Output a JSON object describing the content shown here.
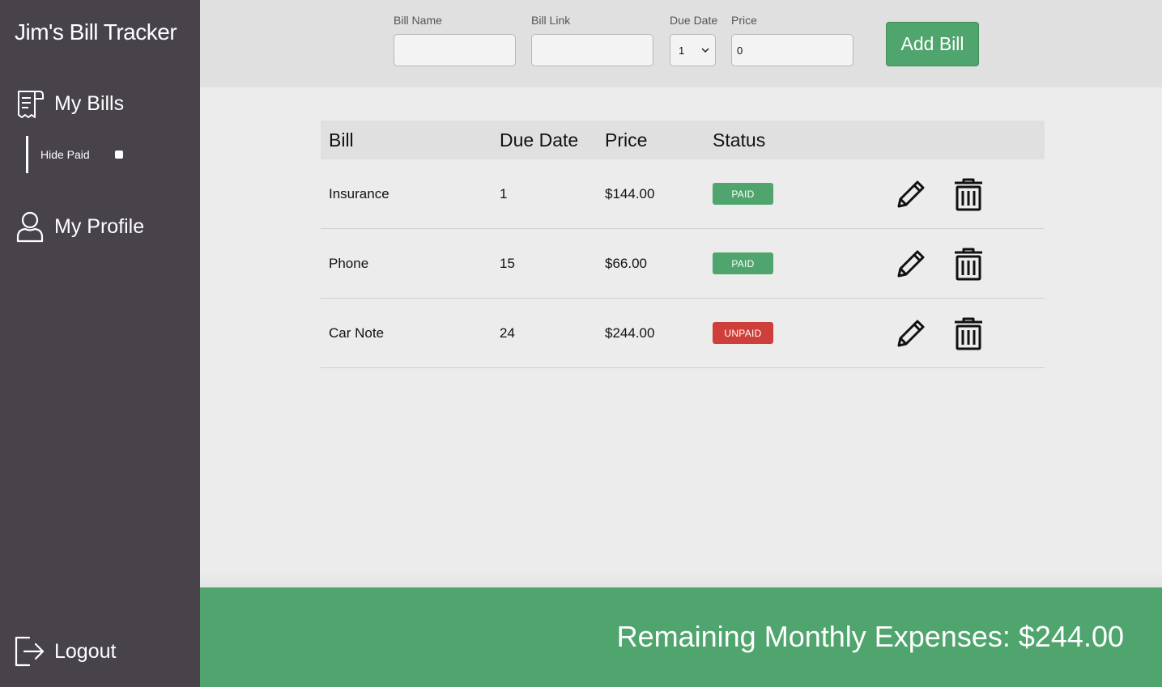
{
  "app": {
    "title": "Jim's Bill Tracker"
  },
  "sidebar": {
    "my_bills": {
      "label": "My Bills",
      "icon": "receipt-icon"
    },
    "hide_paid": {
      "label": "Hide Paid",
      "checked": false
    },
    "my_profile": {
      "label": "My Profile",
      "icon": "user-icon"
    },
    "logout": {
      "label": "Logout",
      "icon": "logout-icon"
    }
  },
  "form": {
    "bill_name": {
      "label": "Bill Name",
      "value": ""
    },
    "bill_link": {
      "label": "Bill Link",
      "value": ""
    },
    "due_date": {
      "label": "Due Date",
      "value": "1"
    },
    "price": {
      "label": "Price",
      "value": "0"
    },
    "add_button": "Add Bill"
  },
  "table": {
    "headers": {
      "bill": "Bill",
      "due_date": "Due Date",
      "price": "Price",
      "status": "Status"
    },
    "rows": [
      {
        "bill": "Insurance",
        "due_date": "1",
        "price": "$144.00",
        "status": "PAID"
      },
      {
        "bill": "Phone",
        "due_date": "15",
        "price": "$66.00",
        "status": "PAID"
      },
      {
        "bill": "Car Note",
        "due_date": "24",
        "price": "$244.00",
        "status": "UNPAID"
      }
    ]
  },
  "footer": {
    "text": "Remaining Monthly Expenses: $244.00"
  },
  "colors": {
    "sidebar_bg": "#48434a",
    "accent_green": "#4fa56d",
    "paid": "#4fa56d",
    "unpaid": "#cf3f3a"
  }
}
